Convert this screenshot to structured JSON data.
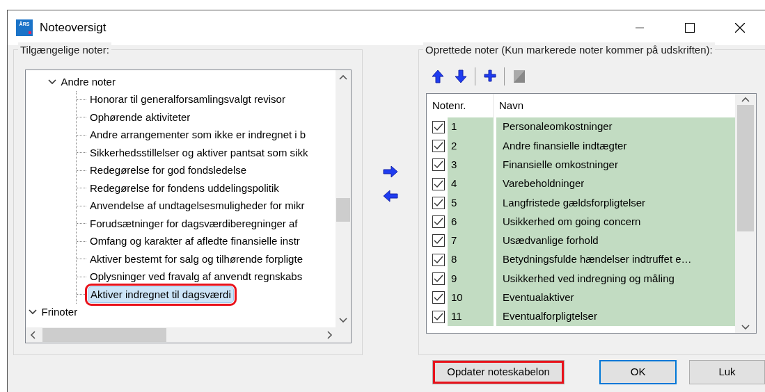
{
  "window": {
    "title": "Noteoversigt",
    "icon_text": "ÅRS"
  },
  "available": {
    "legend": "Tilgængelige noter:",
    "tree": [
      {
        "label": "Andre noter",
        "expanded": true,
        "selected": false,
        "highlighted": false,
        "children": [
          {
            "label": "Honorar til generalforsamlingsvalgt revisor",
            "selected": false,
            "highlighted": false
          },
          {
            "label": "Ophørende aktiviteter",
            "selected": false,
            "highlighted": false
          },
          {
            "label": "Andre arrangementer som ikke er indregnet i b",
            "selected": false,
            "highlighted": false
          },
          {
            "label": "Sikkerhedsstillelser og aktiver pantsat som sikk",
            "selected": false,
            "highlighted": false
          },
          {
            "label": "Redegørelse for god fondsledelse",
            "selected": false,
            "highlighted": false
          },
          {
            "label": "Redegørelse for fondens uddelingspolitik",
            "selected": false,
            "highlighted": false
          },
          {
            "label": "Anvendelse af undtagelsesmuligheder for mikr",
            "selected": false,
            "highlighted": false
          },
          {
            "label": "Forudsætninger for dagsværdiberegninger af",
            "selected": false,
            "highlighted": false
          },
          {
            "label": "Omfang og karakter af afledte finansielle instr",
            "selected": false,
            "highlighted": false
          },
          {
            "label": "Aktiver bestemt for salg og tilhørende forpligte",
            "selected": false,
            "highlighted": false
          },
          {
            "label": "Oplysninger ved fravalg af anvendt regnskabs",
            "selected": false,
            "highlighted": false
          },
          {
            "label": "Aktiver indregnet til dagsværdi",
            "selected": true,
            "highlighted": true
          }
        ]
      },
      {
        "label": "Frinoter",
        "expanded": true,
        "selected": false,
        "highlighted": false
      }
    ]
  },
  "created": {
    "legend": "Oprettede noter (Kun markerede noter kommer på udskriften):",
    "toolbar": [
      {
        "kind": "up",
        "disabled": false
      },
      {
        "kind": "down",
        "disabled": false
      },
      {
        "kind": "separator"
      },
      {
        "kind": "add",
        "disabled": false
      },
      {
        "kind": "separator"
      },
      {
        "kind": "edit",
        "disabled": true
      }
    ],
    "columns": [
      "Notenr.",
      "Navn"
    ],
    "rows": [
      {
        "number": "1",
        "name": "Personaleomkostninger",
        "checked": true
      },
      {
        "number": "2",
        "name": "Andre finansielle indtægter",
        "checked": true
      },
      {
        "number": "3",
        "name": "Finansielle omkostninger",
        "checked": true
      },
      {
        "number": "4",
        "name": "Varebeholdninger",
        "checked": true
      },
      {
        "number": "5",
        "name": "Langfristede gældsforpligtelser",
        "checked": true
      },
      {
        "number": "6",
        "name": "Usikkerhed om going concern",
        "checked": true
      },
      {
        "number": "7",
        "name": "Usædvanlige forhold",
        "checked": true
      },
      {
        "number": "8",
        "name": "Betydningsfulde hændelser indtruffet e…",
        "checked": true
      },
      {
        "number": "9",
        "name": "Usikkerhed ved indregning og måling",
        "checked": true
      },
      {
        "number": "10",
        "name": "Eventualaktiver",
        "checked": true
      },
      {
        "number": "11",
        "name": "Eventualforpligtelser",
        "checked": true
      }
    ]
  },
  "buttons": [
    {
      "label": "Opdater noteskabelon",
      "default": false,
      "highlighted": true
    },
    {
      "label": "OK",
      "default": true,
      "highlighted": false
    },
    {
      "label": "Luk",
      "default": false,
      "highlighted": false
    }
  ]
}
